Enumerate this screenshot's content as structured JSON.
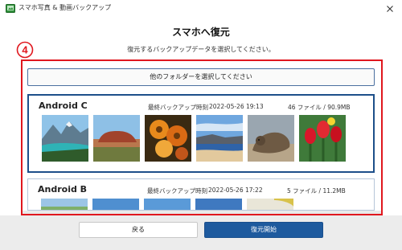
{
  "window": {
    "title": "スマホ写真 & 動画バックアップ",
    "icon": "app-icon",
    "close_icon": "close-icon"
  },
  "page": {
    "heading": "スマホへ復元",
    "subheading": "復元するバックアップデータを選択してください。",
    "step_badge": "④",
    "step_badge_color": "#e0171e",
    "folder_button": "他のフォルダーを選択してください"
  },
  "backups": [
    {
      "device": "Android C",
      "last_backup_label": "最終バックアップ時刻",
      "last_backup_time": "2022-05-26 19:13",
      "files": "46 ファイル / 90.9MB",
      "selected": true,
      "thumbnails": [
        "lake-mountain-photo",
        "red-rock-photo",
        "orange-flowers-photo",
        "coast-photo",
        "seal-photo",
        "red-tulips-photo"
      ]
    },
    {
      "device": "Android B",
      "last_backup_label": "最終バックアップ時刻",
      "last_backup_time": "2022-05-26 17:22",
      "files": "5 ファイル / 11.2MB",
      "selected": false,
      "thumbnails": [
        "green-field-photo",
        "blue-sky-photo",
        "blue-sky-photo-2",
        "blue-photo",
        "flower-photo"
      ]
    }
  ],
  "footer": {
    "back_button": "戻る",
    "restore_button": "復元開始"
  },
  "colors": {
    "accent": "#1e5a9e",
    "selected_border": "#1d4f8a",
    "highlight_frame": "#e0171e"
  }
}
